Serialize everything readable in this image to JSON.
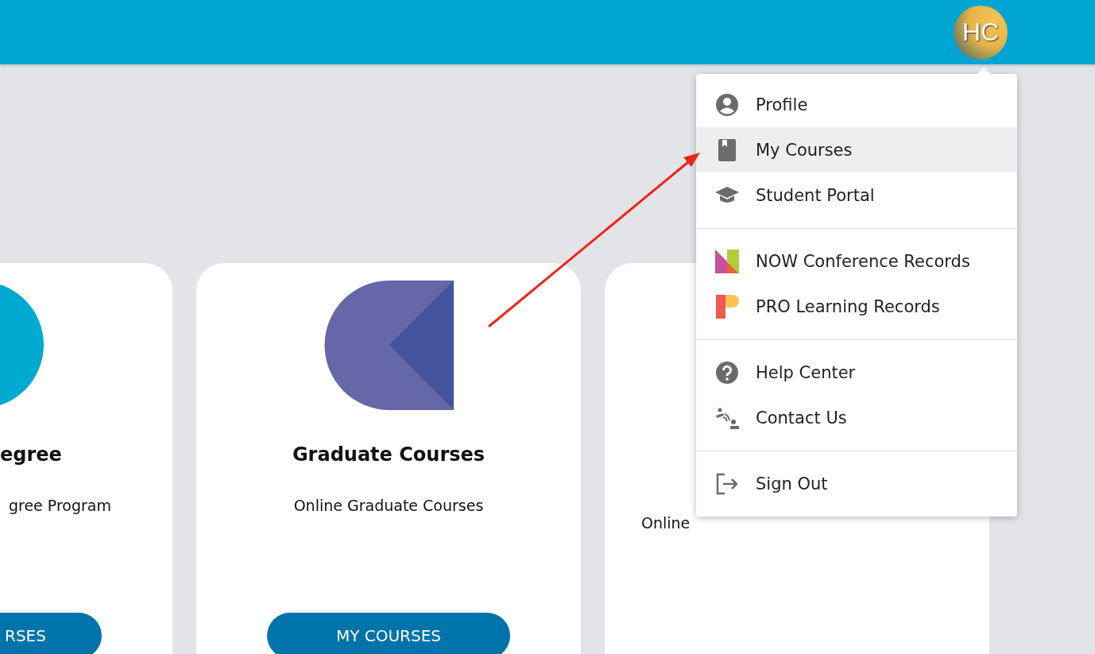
{
  "header": {
    "avatar": {
      "initials": "HC"
    }
  },
  "cards": [
    {
      "kind": "degree",
      "title": "egree",
      "subtitle": "gree Program",
      "button": "RSES"
    },
    {
      "kind": "graduate",
      "title": "Graduate Courses",
      "subtitle": "Online Graduate Courses",
      "button": "MY COURSES"
    },
    {
      "kind": "online",
      "subtitle": "Online"
    }
  ],
  "menu": {
    "groups": [
      {
        "items": [
          {
            "kind": "person",
            "label": "Profile",
            "selected": false
          },
          {
            "kind": "book",
            "label": "My Courses",
            "selected": true
          },
          {
            "kind": "cap",
            "label": "Student Portal",
            "selected": false
          }
        ]
      },
      {
        "items": [
          {
            "kind": "now",
            "label": "NOW Conference Records",
            "selected": false
          },
          {
            "kind": "pro",
            "label": "PRO Learning Records",
            "selected": false
          }
        ]
      },
      {
        "items": [
          {
            "kind": "help",
            "label": "Help Center",
            "selected": false
          },
          {
            "kind": "contact",
            "label": "Contact Us",
            "selected": false
          }
        ]
      },
      {
        "items": [
          {
            "kind": "signout",
            "label": "Sign Out",
            "selected": false
          }
        ]
      }
    ]
  }
}
